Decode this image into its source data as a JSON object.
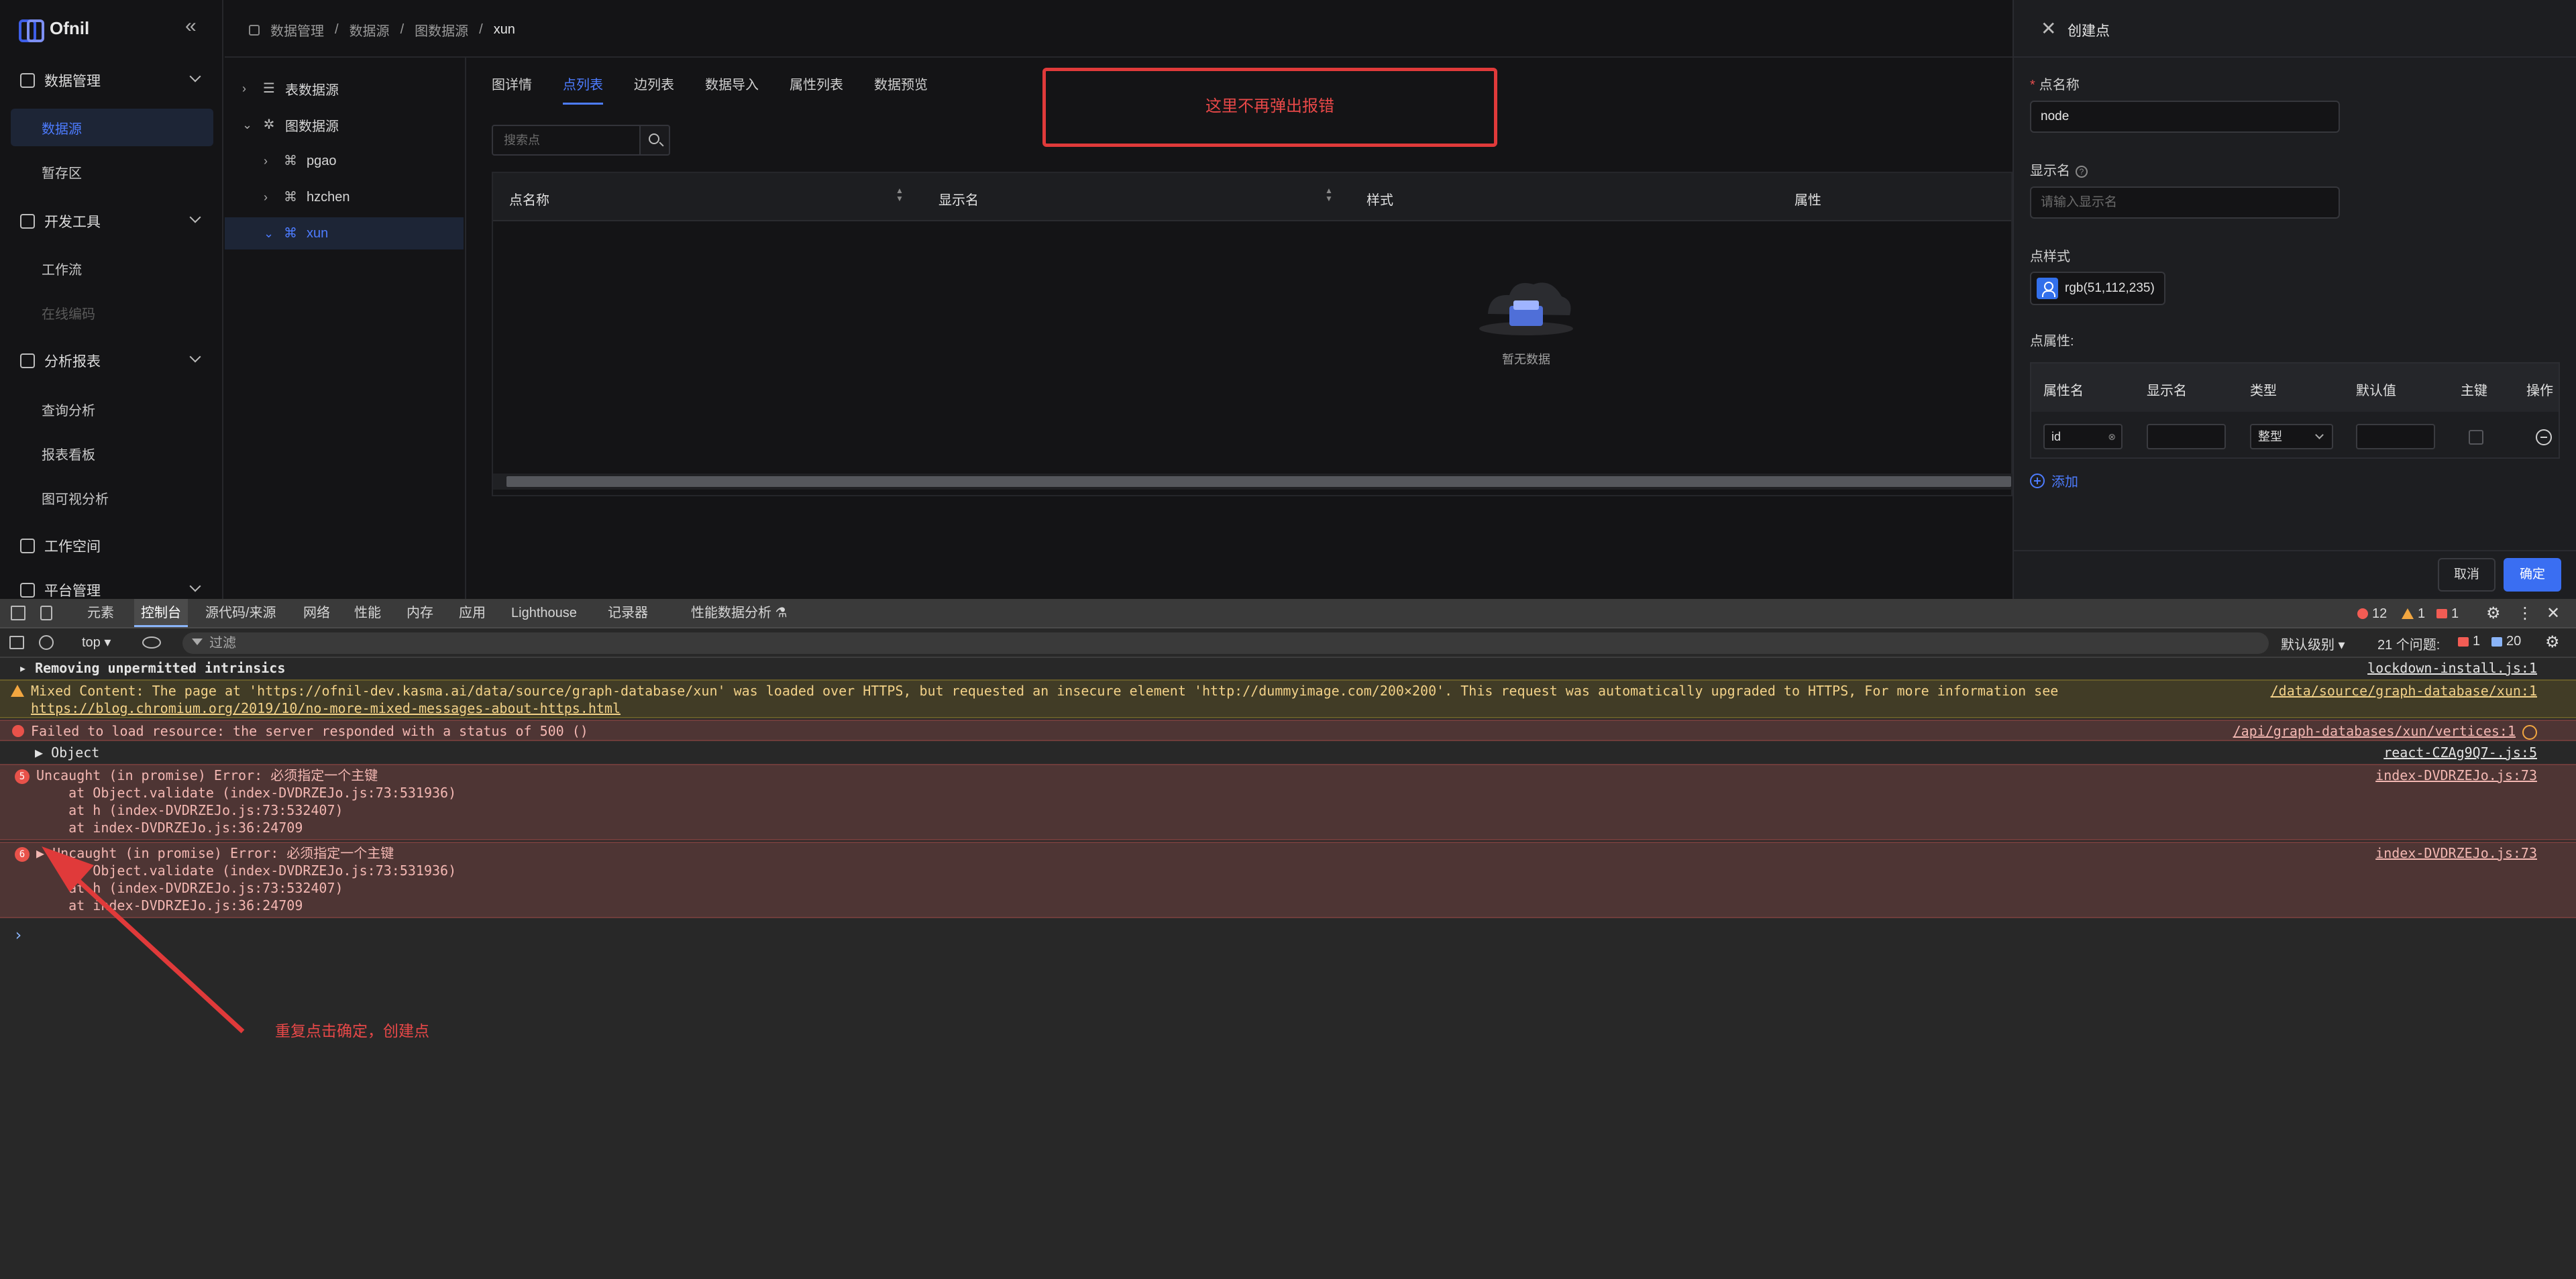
{
  "app": {
    "logo": "Ofnil",
    "collapse_icon": "«",
    "breadcrumb": [
      "数据管理",
      "数据源",
      "图数据源",
      "xun"
    ]
  },
  "sidebar": {
    "groups": [
      {
        "label": "数据管理",
        "items": [
          {
            "label": "数据源",
            "active": true
          },
          {
            "label": "暂存区"
          }
        ]
      },
      {
        "label": "开发工具",
        "items": [
          {
            "label": "工作流"
          },
          {
            "label": "在线编码",
            "disabled": true
          }
        ]
      },
      {
        "label": "分析报表",
        "items": [
          {
            "label": "查询分析"
          },
          {
            "label": "报表看板"
          },
          {
            "label": "图可视分析"
          }
        ]
      },
      {
        "label": "工作空间",
        "items": []
      },
      {
        "label": "平台管理",
        "items": []
      }
    ]
  },
  "tree": {
    "nodes": [
      {
        "label": "表数据源",
        "arrow": "›",
        "icon": "database-icon"
      },
      {
        "label": "图数据源",
        "arrow": "⌄",
        "icon": "graph-icon"
      },
      {
        "label": "pgao",
        "arrow": "›",
        "icon": "graph-node-icon"
      },
      {
        "label": "hzchen",
        "arrow": "›",
        "icon": "graph-node-icon"
      },
      {
        "label": "xun",
        "arrow": "⌄",
        "icon": "graph-node-icon",
        "selected": true
      }
    ]
  },
  "main": {
    "tabs": [
      "图详情",
      "点列表",
      "边列表",
      "数据导入",
      "属性列表",
      "数据预览"
    ],
    "active_tab": 1,
    "search_placeholder": "搜索点",
    "columns": [
      "点名称",
      "显示名",
      "样式",
      "属性"
    ],
    "empty_text": "暂无数据"
  },
  "annotations": {
    "box_text": "这里不再弹出报错",
    "arrow_text": "重复点击确定，创建点",
    "color": "#e03a3a"
  },
  "drawer": {
    "title": "创建点",
    "name_label": "点名称",
    "name_value": "node",
    "display_label": "显示名",
    "display_placeholder": "请输入显示名",
    "style_label": "点样式",
    "style_value": "rgb(51,112,235)",
    "style_color": "#3370eb",
    "props_label": "点属性:",
    "prop_columns": [
      "属性名",
      "显示名",
      "类型",
      "默认值",
      "主键",
      "操作"
    ],
    "prop_row": {
      "name": "id",
      "display": "",
      "type": "整型",
      "default": ""
    },
    "add_label": "添加",
    "cancel_label": "取消",
    "ok_label": "确定"
  },
  "devtools": {
    "tabs": [
      "元素",
      "控制台",
      "源代码/来源",
      "网络",
      "性能",
      "内存",
      "应用",
      "Lighthouse",
      "记录器",
      "性能数据分析 ⚗"
    ],
    "active_tab": 1,
    "badges": {
      "errors": "12",
      "warnings": "1",
      "issues": "1"
    },
    "context": "top",
    "filter_placeholder": "过滤",
    "level": "默认级别",
    "issues_label": "21 个问题:",
    "issue_err": "1",
    "issue_info": "20"
  },
  "console": {
    "lines": [
      {
        "type": "log",
        "text": "Removing unpermitted intrinsics",
        "src": "lockdown-install.js:1"
      },
      {
        "type": "warn",
        "text": "Mixed Content: The page at 'https://ofnil-dev.kasma.ai/data/source/graph-database/xun' was loaded over HTTPS, but requested an insecure element 'http://dummyimage.com/200×200'. This request was automatically upgraded to HTTPS, For more information see",
        "text2": "https://blog.chromium.org/2019/10/no-more-mixed-messages-about-https.html",
        "src": "/data/source/graph-database/xun:1"
      },
      {
        "type": "err",
        "text": "Failed to load resource: the server responded with a status of 500 ()",
        "src": "/api/graph-databases/xun/vertices:1"
      },
      {
        "type": "log",
        "text": "▶ Object",
        "src": "react-CZAg9Q7-.js:5"
      },
      {
        "type": "err",
        "count": "5",
        "text": "Uncaught (in promise) Error: 必须指定一个主键",
        "stack": [
          "    at Object.validate (index-DVDRZEJo.js:73:531936)",
          "    at h (index-DVDRZEJo.js:73:532407)",
          "    at index-DVDRZEJo.js:36:24709"
        ],
        "src": "index-DVDRZEJo.js:73"
      },
      {
        "type": "err",
        "count": "6",
        "text": "▶ Uncaught (in promise) Error: 必须指定一个主键",
        "stack": [
          "    at Object.validate (index-DVDRZEJo.js:73:531936)",
          "    at h (index-DVDRZEJo.js:73:532407)",
          "    at index-DVDRZEJo.js:36:24709"
        ],
        "src": "index-DVDRZEJo.js:73"
      }
    ],
    "prompt": "›"
  }
}
